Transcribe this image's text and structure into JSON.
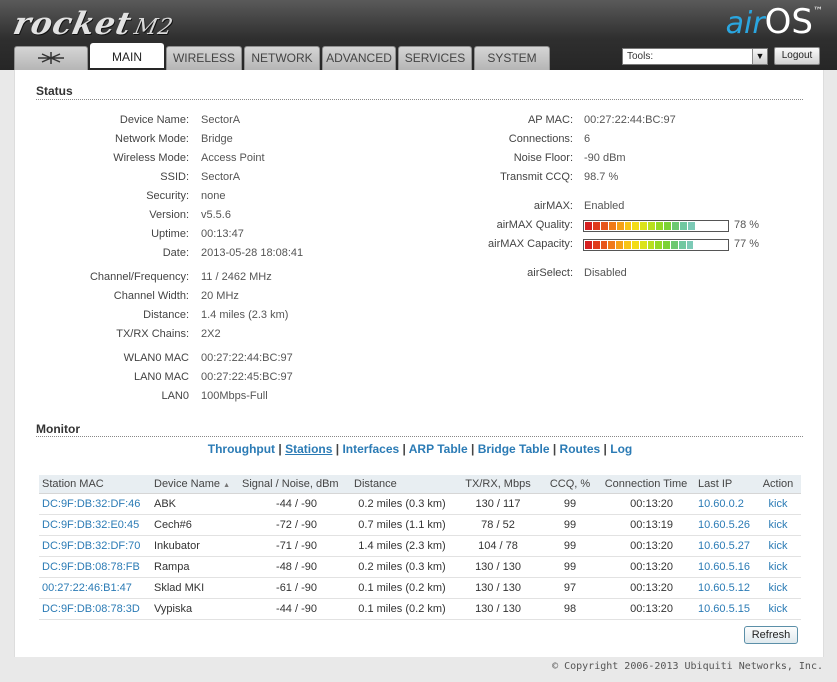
{
  "brand": {
    "product": "rocket",
    "model": "M2",
    "os_prefix": "air",
    "os_name": "OS",
    "trademark": "™"
  },
  "tabs": [
    {
      "label": "",
      "icon": "ubiquiti-logo-icon"
    },
    {
      "label": "MAIN"
    },
    {
      "label": "WIRELESS"
    },
    {
      "label": "NETWORK"
    },
    {
      "label": "ADVANCED"
    },
    {
      "label": "SERVICES"
    },
    {
      "label": "SYSTEM"
    }
  ],
  "active_tab": "MAIN",
  "tools": {
    "label": "Tools:",
    "logout": "Logout"
  },
  "status": {
    "title": "Status",
    "left": [
      {
        "label": "Device Name:",
        "value": "SectorA"
      },
      {
        "label": "Network Mode:",
        "value": "Bridge"
      },
      {
        "label": "Wireless Mode:",
        "value": "Access Point"
      },
      {
        "label": "SSID:",
        "value": "SectorA"
      },
      {
        "label": "Security:",
        "value": "none"
      },
      {
        "label": "Version:",
        "value": "v5.5.6"
      },
      {
        "label": "Uptime:",
        "value": "00:13:47"
      },
      {
        "label": "Date:",
        "value": "2013-05-28 18:08:41"
      },
      {
        "label": "Channel/Frequency:",
        "value": "11 / 2462 MHz"
      },
      {
        "label": "Channel Width:",
        "value": "20 MHz"
      },
      {
        "label": "Distance:",
        "value": "1.4 miles (2.3 km)"
      },
      {
        "label": "TX/RX Chains:",
        "value": "2X2"
      },
      {
        "label": "WLAN0 MAC",
        "value": "00:27:22:44:BC:97"
      },
      {
        "label": "LAN0 MAC",
        "value": "00:27:22:45:BC:97"
      },
      {
        "label": "LAN0",
        "value": "100Mbps-Full"
      }
    ],
    "right": [
      {
        "label": "AP MAC:",
        "value": "00:27:22:44:BC:97"
      },
      {
        "label": "Connections:",
        "value": "6"
      },
      {
        "label": "Noise Floor:",
        "value": "-90 dBm"
      },
      {
        "label": "Transmit CCQ:",
        "value": "98.7 %"
      },
      {
        "label": "airMAX:",
        "value": "Enabled"
      },
      {
        "label": "airMAX Quality:",
        "value": "78 %",
        "level": 0.78
      },
      {
        "label": "airMAX Capacity:",
        "value": "77 %",
        "level": 0.77
      },
      {
        "label": "airSelect:",
        "value": "Disabled"
      }
    ]
  },
  "monitor": {
    "title": "Monitor",
    "links": [
      "Throughput",
      "Stations",
      "Interfaces",
      "ARP Table",
      "Bridge Table",
      "Routes",
      "Log"
    ],
    "separator": " | ",
    "current_link": "Stations",
    "columns": [
      "Station MAC",
      "Device Name",
      "Signal / Noise, dBm",
      "Distance",
      "TX/RX, Mbps",
      "CCQ, %",
      "Connection Time",
      "Last IP",
      "Action"
    ],
    "sort_indicator": "▲",
    "rows": [
      [
        "DC:9F:DB:32:DF:46",
        "ABK",
        "-44 / -90",
        "0.2 miles (0.3 km)",
        "130 / 117",
        "99",
        "00:13:20",
        "10.60.0.2",
        "kick"
      ],
      [
        "DC:9F:DB:32:E0:45",
        "Cech#6",
        "-72 / -90",
        "0.7 miles (1.1 km)",
        "78 / 52",
        "99",
        "00:13:19",
        "10.60.5.26",
        "kick"
      ],
      [
        "DC:9F:DB:32:DF:70",
        "Inkubator",
        "-71 / -90",
        "1.4 miles (2.3 km)",
        "104 / 78",
        "99",
        "00:13:20",
        "10.60.5.27",
        "kick"
      ],
      [
        "DC:9F:DB:08:78:FB",
        "Rampa",
        "-48 / -90",
        "0.2 miles (0.3 km)",
        "130 / 130",
        "99",
        "00:13:20",
        "10.60.5.16",
        "kick"
      ],
      [
        "00:27:22:46:B1:47",
        "Sklad MKI",
        "-61 / -90",
        "0.1 miles (0.2 km)",
        "130 / 130",
        "97",
        "00:13:20",
        "10.60.5.12",
        "kick"
      ],
      [
        "DC:9F:DB:08:78:3D",
        "Vypiska",
        "-44 / -90",
        "0.1 miles (0.2 km)",
        "130 / 130",
        "98",
        "00:13:20",
        "10.60.5.15",
        "kick"
      ]
    ],
    "refresh": "Refresh"
  },
  "footer": {
    "copyright": "© Copyright 2006-2013 Ubiquiti Networks, Inc."
  },
  "colors": {
    "link": "#2b7bb5",
    "header": "#3a3a3a",
    "airos_accent": "#2aa6e0"
  }
}
